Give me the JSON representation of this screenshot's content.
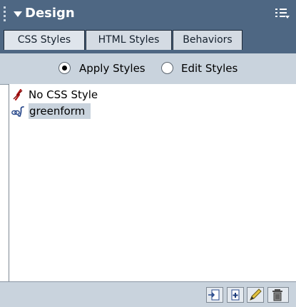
{
  "panel": {
    "title": "Design",
    "options_icon": "options-menu-icon"
  },
  "tabs": [
    {
      "label": "CSS Styles",
      "active": true
    },
    {
      "label": "HTML Styles",
      "active": false
    },
    {
      "label": "Behaviors",
      "active": false
    }
  ],
  "mode": {
    "apply_label": "Apply Styles",
    "edit_label": "Edit Styles",
    "selected": "apply"
  },
  "styles": [
    {
      "name": "No CSS Style",
      "icon": "no-style-icon",
      "selected": false
    },
    {
      "name": "greenform",
      "icon": "linked-style-icon",
      "selected": true
    }
  ],
  "toolbar": {
    "buttons": [
      "attach-stylesheet-icon",
      "new-style-icon",
      "edit-stylesheet-icon",
      "delete-style-icon"
    ]
  },
  "colors": {
    "titlebar": "#4e6783",
    "panel_bg": "#c9d3dd",
    "selection": "#c9d3dd"
  }
}
